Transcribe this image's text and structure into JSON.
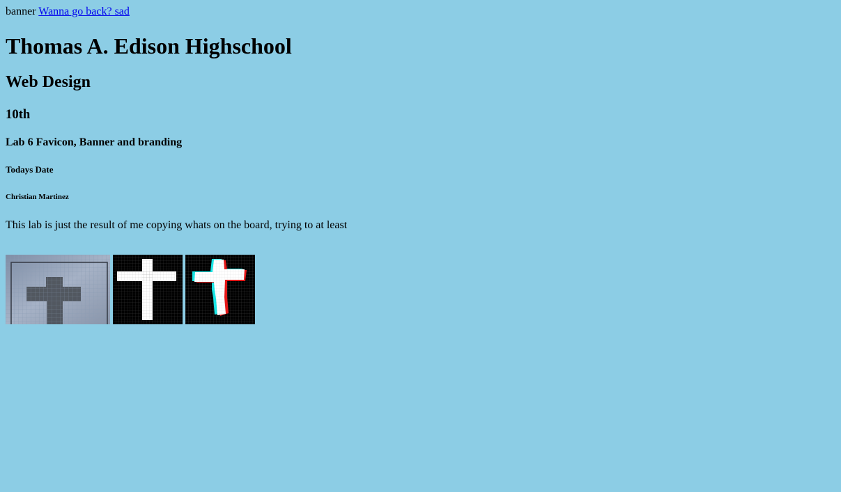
{
  "header": {
    "banner_alt": "banner",
    "back_link": "Wanna go back? sad"
  },
  "headings": {
    "school": "Thomas A. Edison Highschool",
    "course": "Web Design",
    "grade": "10th",
    "lab": "Lab 6 Favicon, Banner and branding",
    "date": "Todays Date",
    "author": "Christian Martinez"
  },
  "body_text": "This lab is just the result of me copying whats on the board, trying to at least",
  "images": [
    {
      "name": "cross-sketch-photo"
    },
    {
      "name": "cross-pixel-grid"
    },
    {
      "name": "cross-glitch-pixel-grid"
    }
  ],
  "colors": {
    "background": "#8ccde5",
    "link": "#0000ee"
  }
}
